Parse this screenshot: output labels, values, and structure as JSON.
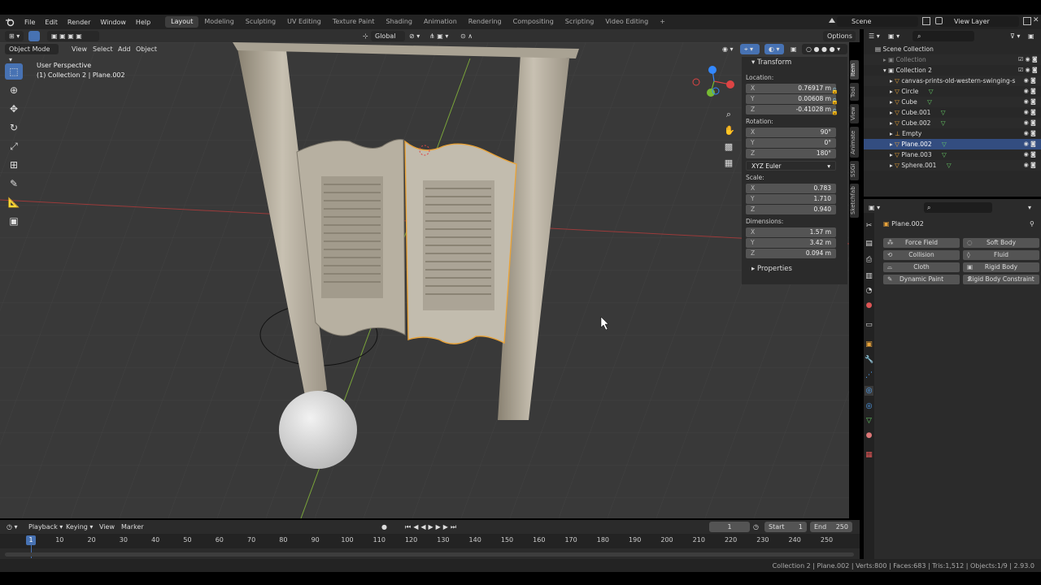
{
  "menu": [
    "File",
    "Edit",
    "Render",
    "Window",
    "Help"
  ],
  "workspaces": [
    "Layout",
    "Modeling",
    "Sculpting",
    "UV Editing",
    "Texture Paint",
    "Shading",
    "Animation",
    "Rendering",
    "Compositing",
    "Scripting",
    "Video Editing"
  ],
  "active_workspace": "Layout",
  "add_workspace": "+",
  "scene": "Scene",
  "view_layer": "View Layer",
  "viewport_header": {
    "mode": "Object Mode",
    "menus": [
      "View",
      "Select",
      "Add",
      "Object"
    ],
    "transform_orientation": "Global",
    "options": "Options"
  },
  "viewport_overlay": {
    "perspective": "User Perspective",
    "collection_info": "(1) Collection 2 | Plane.002"
  },
  "npanel": {
    "title": "Transform",
    "location_label": "Location:",
    "location": [
      {
        "k": "X",
        "v": "0.76917 m"
      },
      {
        "k": "Y",
        "v": "0.00608 m"
      },
      {
        "k": "Z",
        "v": "-0.41028 m"
      }
    ],
    "rotation_label": "Rotation:",
    "rotation": [
      {
        "k": "X",
        "v": "90°"
      },
      {
        "k": "Y",
        "v": "0°"
      },
      {
        "k": "Z",
        "v": "180°"
      }
    ],
    "rotation_mode": "XYZ Euler",
    "scale_label": "Scale:",
    "scale": [
      {
        "k": "X",
        "v": "0.783"
      },
      {
        "k": "Y",
        "v": "1.710"
      },
      {
        "k": "Z",
        "v": "0.940"
      }
    ],
    "dimensions_label": "Dimensions:",
    "dimensions": [
      {
        "k": "X",
        "v": "1.57 m"
      },
      {
        "k": "Y",
        "v": "3.42 m"
      },
      {
        "k": "Z",
        "v": "0.094 m"
      }
    ],
    "properties": "Properties",
    "tabs": [
      "Item",
      "Tool",
      "View",
      "Animate",
      "SSGI",
      "Sketchfab"
    ]
  },
  "outliner": {
    "root": "Scene Collection",
    "rows": [
      {
        "name": "Collection",
        "kind": "collection",
        "dim": true
      },
      {
        "name": "Collection 2",
        "kind": "collection",
        "dim": false
      },
      {
        "name": "canvas-prints-old-western-swinging-s",
        "kind": "object",
        "dim": false
      },
      {
        "name": "Circle",
        "kind": "object",
        "dim": false
      },
      {
        "name": "Cube",
        "kind": "object",
        "dim": false
      },
      {
        "name": "Cube.001",
        "kind": "object",
        "dim": false
      },
      {
        "name": "Cube.002",
        "kind": "object",
        "dim": false
      },
      {
        "name": "Empty",
        "kind": "empty",
        "dim": false
      },
      {
        "name": "Plane.002",
        "kind": "object",
        "dim": false,
        "selected": true
      },
      {
        "name": "Plane.003",
        "kind": "object",
        "dim": false
      },
      {
        "name": "Sphere.001",
        "kind": "object",
        "dim": false
      }
    ]
  },
  "properties": {
    "object_name": "Plane.002",
    "physics_buttons": [
      [
        "Force Field",
        "Soft Body"
      ],
      [
        "Collision",
        "Fluid"
      ],
      [
        "Cloth",
        "Rigid Body"
      ],
      [
        "Dynamic Paint",
        "Rigid Body Constraint"
      ]
    ]
  },
  "timeline": {
    "menus": [
      "Playback",
      "Keying",
      "View",
      "Marker"
    ],
    "current_frame": "1",
    "start_label": "Start",
    "start": "1",
    "end_label": "End",
    "end": "250",
    "ticks": [
      "10",
      "20",
      "30",
      "40",
      "50",
      "60",
      "70",
      "80",
      "90",
      "100",
      "110",
      "120",
      "130",
      "140",
      "150",
      "160",
      "170",
      "180",
      "190",
      "200",
      "210",
      "220",
      "230",
      "240",
      "250"
    ]
  },
  "status": "Collection 2 | Plane.002 | Verts:800 | Faces:683 | Tris:1,512 | Objects:1/9 | 2.93.0",
  "colors": {
    "accent": "#4772b3",
    "selected_outline": "#e8a33a",
    "x_axis": "#b34b4b",
    "y_axis": "#85b33d"
  }
}
